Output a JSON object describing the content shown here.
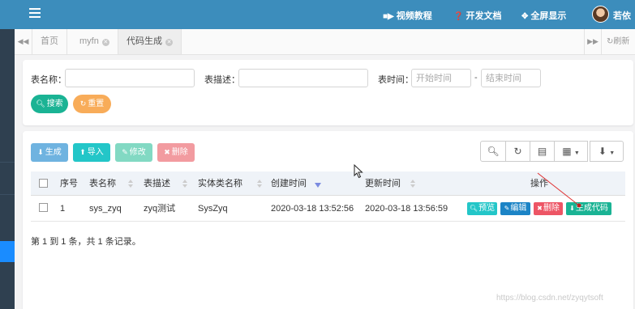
{
  "header": {
    "links": [
      {
        "label": "视频教程",
        "icon": "video-icon"
      },
      {
        "label": "开发文档",
        "icon": "help-circle-icon"
      },
      {
        "label": "全屏显示",
        "icon": "fullscreen-icon"
      }
    ],
    "user_name": "若依"
  },
  "tabs": {
    "items": [
      {
        "label": "首页",
        "closable": false
      },
      {
        "label": "myfn",
        "closable": true
      },
      {
        "label": "代码生成",
        "closable": true
      }
    ],
    "refresh_label": "刷新"
  },
  "search": {
    "table_name_label": "表名称：",
    "table_desc_label": "表描述：",
    "table_time_label": "表时间：",
    "start_placeholder": "开始时间",
    "end_placeholder": "结束时间",
    "range_separator": "-",
    "search_button": "搜索",
    "reset_button": "重置"
  },
  "toolbar": {
    "generate": "生成",
    "import": "导入",
    "edit": "修改",
    "delete": "删除"
  },
  "table": {
    "columns": [
      "序号",
      "表名称",
      "表描述",
      "实体类名称",
      "创建时间",
      "更新时间",
      "操作"
    ],
    "rows": [
      {
        "index": "1",
        "table_name": "sys_zyq",
        "table_desc": "zyq测试",
        "class_name": "SysZyq",
        "create_time": "2020-03-18 13:52:56",
        "update_time": "2020-03-18 13:56:59",
        "actions": [
          "预览",
          "编辑",
          "删除",
          "生成代码"
        ]
      }
    ],
    "page_info": "第 1 到 1 条，共 1 条记录。"
  },
  "watermark": "https://blog.csdn.net/zyqytsoft",
  "colors": {
    "header": "#3c8dbc",
    "green": "#1ab394",
    "orange": "#f8ac59",
    "danger": "#ed5565",
    "info": "#23c6c8",
    "primary": "#1c84c6"
  }
}
